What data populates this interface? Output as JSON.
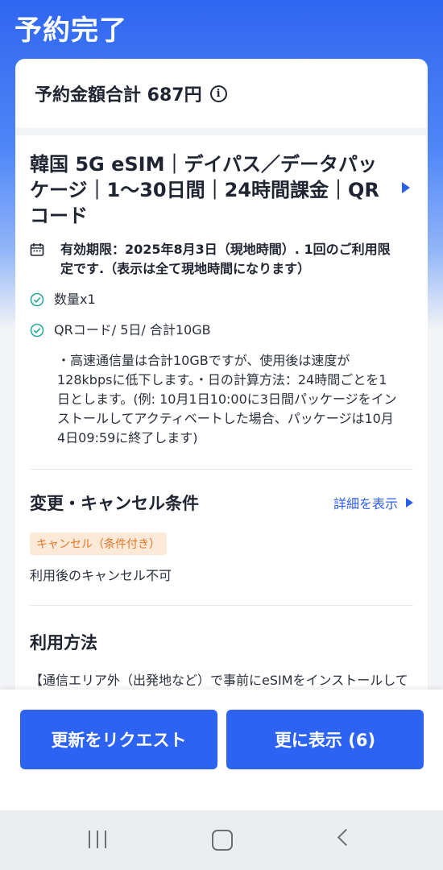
{
  "header": {
    "title": "予約完了"
  },
  "summary": {
    "total_label": "予約金額合計 687円"
  },
  "product": {
    "title": "韓国 5G eSIM｜デイパス／データパッケージ｜1〜30日間｜24時間課金｜QRコード",
    "validity": "有効期限：2025年8月3日（現地時間）. 1回のご利用限定です.（表示は全て現地時間になります）",
    "quantity": "数量x1",
    "plan": "QRコード/ 5日/ 合計10GB",
    "description": "・高速通信量は合計10GBですが、使用後は速度が128kbpsに低下します。・日の計算方法：24時間ごとを1日とします。(例: 10月1日10:00に3日間パッケージをインストールしてアクティベートした場合、パッケージは10月4日09:59に終了します)"
  },
  "cancellation": {
    "title": "変更・キャンセル条件",
    "detail_link": "詳細を表示",
    "badge": "キャンセル（条件付き）",
    "policy": "利用後のキャンセル不可"
  },
  "usage": {
    "title": "利用方法",
    "text": "【通信エリア外（出発地など）で事前にeSIMをインストールしても、プランの有効化は行われません。目的地"
  },
  "actions": {
    "request_update": "更新をリクエスト",
    "show_more": "更に表示 (6)"
  },
  "icons": {
    "info": "info-icon",
    "calendar": "calendar-icon",
    "check": "check-circle-icon",
    "chevron": "chevron-right-icon"
  },
  "colors": {
    "primary": "#2d63f2",
    "badge_bg": "#fde9d8",
    "badge_text": "#e7772a"
  }
}
